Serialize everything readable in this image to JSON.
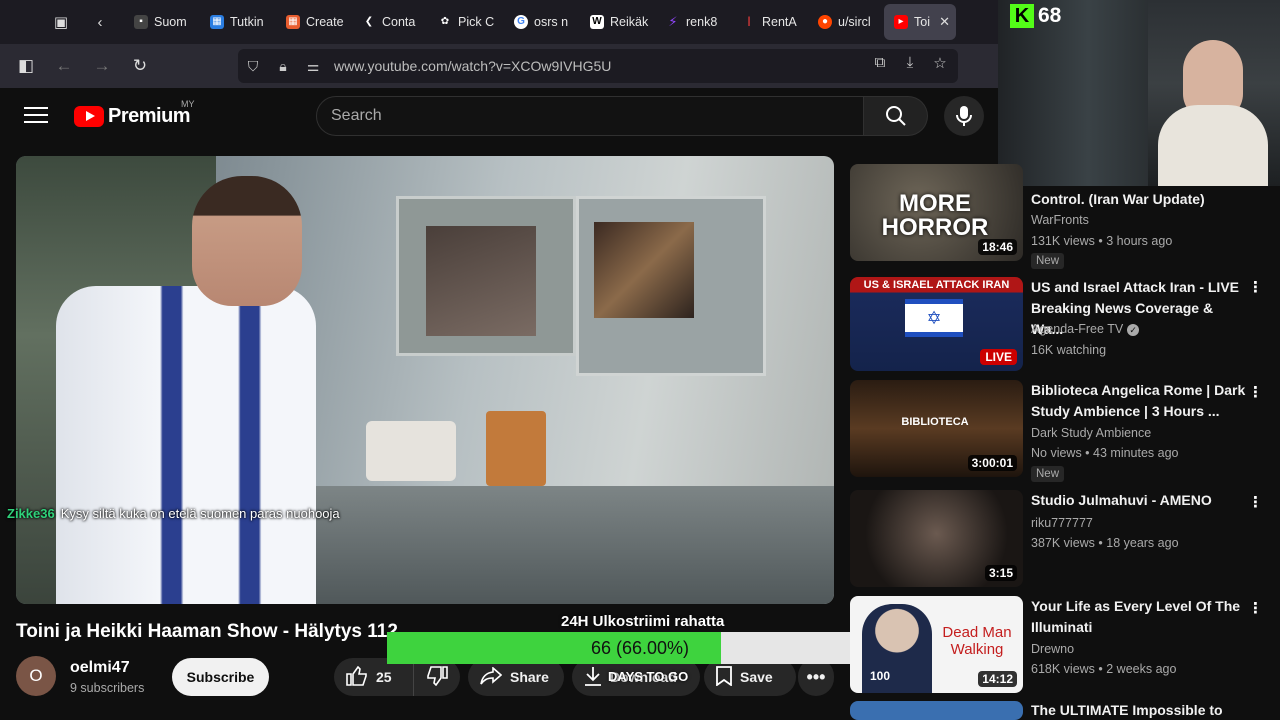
{
  "browser": {
    "tabs": [
      {
        "label": "Suom",
        "icon": "video-icon",
        "color": "#444"
      },
      {
        "label": "Tutkin",
        "icon": "grid-icon",
        "color": "#2a7de1"
      },
      {
        "label": "Create",
        "icon": "palette-icon",
        "color": "#e85d2f"
      },
      {
        "label": "Conta",
        "icon": "shoe-icon",
        "color": "#ffffff"
      },
      {
        "label": "Pick C",
        "icon": "flower-icon",
        "color": "#ffffff"
      },
      {
        "label": "osrs n",
        "icon": "google-icon",
        "color": "#ffffff"
      },
      {
        "label": "Reikäk",
        "icon": "wikipedia-icon",
        "color": "#ffffff"
      },
      {
        "label": "renk8",
        "icon": "twitch-icon",
        "color": "#9146ff"
      },
      {
        "label": "RentA",
        "icon": "renta-icon",
        "color": "#e03a3a"
      },
      {
        "label": "u/sircl",
        "icon": "reddit-icon",
        "color": "#ff4500"
      }
    ],
    "active_tab": {
      "label": "Toi",
      "icon": "youtube-icon",
      "color": "#ff0000"
    },
    "url": "www.youtube.com/watch?v=XCOw9IVHG5U"
  },
  "youtube": {
    "logo_text": "Premium",
    "region": "MY",
    "search_placeholder": "Search"
  },
  "chat": {
    "user": "Zikke36",
    "message": "Kysy siltä kuka on etelä suomen paras nuohooja"
  },
  "video": {
    "title": "Toini ja Heikki Haaman Show - Hälytys 112",
    "avatar_letter": "O",
    "channel": "oelmi47",
    "subscribers": "9 subscribers",
    "subscribe_label": "Subscribe",
    "likes": "25",
    "share_label": "Share",
    "download_label": "Download",
    "save_label": "Save"
  },
  "overlay": {
    "subathon_title": "24H Ulkostriimi rahatta",
    "progress_text": "66 (66.00%)",
    "progress_fraction": 0.66,
    "days_text": "DAYS TO GO",
    "kick_viewers": "68",
    "accent": "#3ed33e"
  },
  "recommendations": [
    {
      "title": "Control. (Iran War Update)",
      "channel": "WarFronts",
      "meta": "131K views • 3 hours ago",
      "badge": "New",
      "duration": "18:46",
      "thumb_text": "MORE HORROR"
    },
    {
      "title": "US and Israel Attack Iran - LIVE Breaking News Coverage & Wa...",
      "channel": "Agenda-Free TV",
      "meta": "16K watching",
      "live": "LIVE",
      "thumb_text": "US & ISRAEL ATTACK IRAN"
    },
    {
      "title": "Biblioteca Angelica Rome | Dark Study Ambience | 3 Hours ...",
      "channel": "Dark Study Ambience",
      "meta": "No views • 43 minutes ago",
      "badge": "New",
      "duration": "3:00:01",
      "thumb_text": "BIBLIOTECA"
    },
    {
      "title": "Studio Julmahuvi - AMENO",
      "channel": "riku777777",
      "meta": "387K views • 18 years ago",
      "duration": "3:15"
    },
    {
      "title": "Your Life as Every Level Of The Illuminati",
      "channel": "Drewno",
      "meta": "618K views • 2 weeks ago",
      "duration": "14:12",
      "thumb_text": "Dead Man Walking",
      "thumb_num": "100"
    },
    {
      "title": "The ULTIMATE Impossible to"
    }
  ]
}
